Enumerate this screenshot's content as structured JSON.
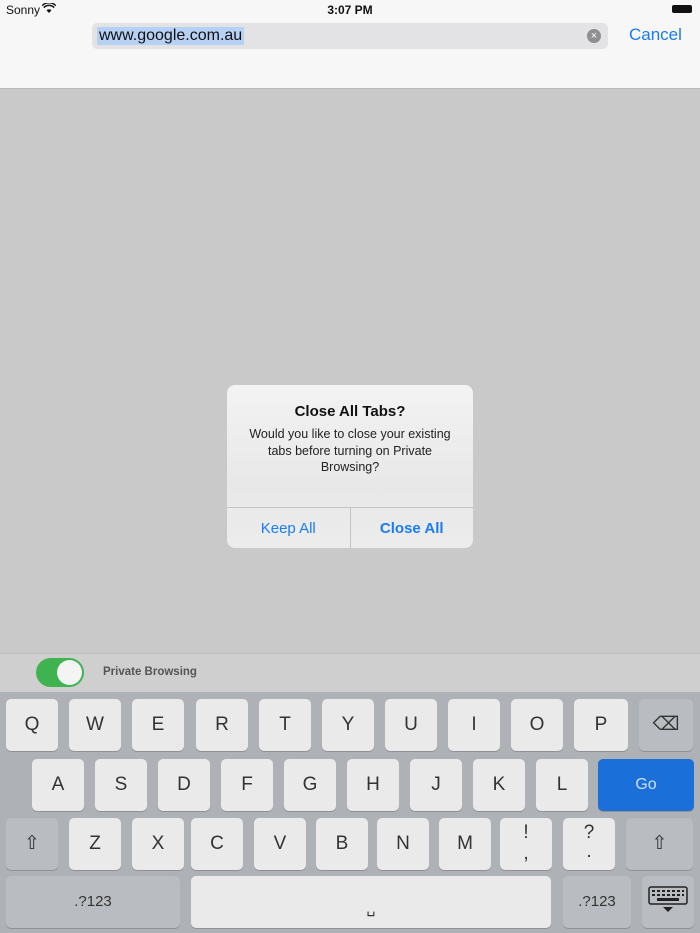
{
  "status_bar": {
    "carrier": "Sonny",
    "time": "3:07 PM"
  },
  "address_bar": {
    "url": "www.google.com.au",
    "cancel_label": "Cancel",
    "clear_glyph": "×"
  },
  "alert": {
    "title": "Close All Tabs?",
    "message": "Would you like to close your existing tabs before turning on Private Browsing?",
    "buttons": {
      "keep_all": "Keep All",
      "close_all": "Close All"
    }
  },
  "private_browsing": {
    "label": "Private Browsing",
    "enabled": true
  },
  "keyboard": {
    "row1": [
      "Q",
      "W",
      "E",
      "R",
      "T",
      "Y",
      "U",
      "I",
      "O",
      "P"
    ],
    "row2": [
      "A",
      "S",
      "D",
      "F",
      "G",
      "H",
      "J",
      "K",
      "L"
    ],
    "row3": [
      "Z",
      "X",
      "C",
      "V",
      "B",
      "N",
      "M"
    ],
    "punct1_top": "!",
    "punct1_bottom": ",",
    "punct2_top": "?",
    "punct2_bottom": ".",
    "go_label": "Go",
    "numbers_label": ".?123",
    "space_glyph": "␣",
    "backspace_glyph": "⌫",
    "shift_glyph": "⇧"
  },
  "colors": {
    "accent": "#1a7cf0",
    "toggle_on": "#3fb34f",
    "go_key": "#1a6fd8"
  }
}
